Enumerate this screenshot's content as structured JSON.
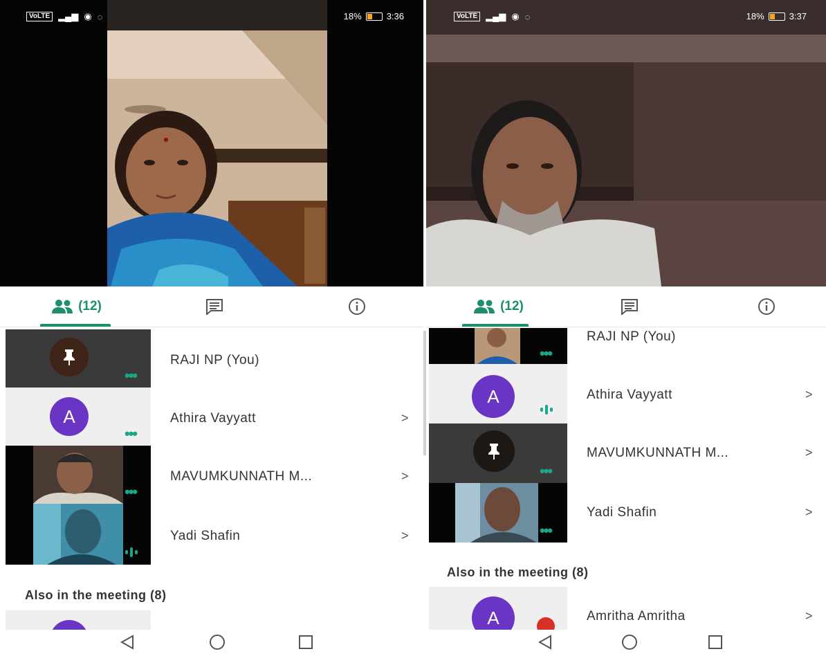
{
  "left": {
    "status": {
      "battery": "18%",
      "time": "3:36"
    },
    "tabs": {
      "people_count": "(12)"
    },
    "participants": [
      {
        "name": "RAJI NP (You)"
      },
      {
        "name": "Athira Vayyatt",
        "initial": "A"
      },
      {
        "name": "MAVUMKUNNATH M..."
      },
      {
        "name": "Yadi Shafin"
      }
    ],
    "also_label": "Also in the meeting (8)"
  },
  "right": {
    "status": {
      "battery": "18%",
      "time": "3:37"
    },
    "tabs": {
      "people_count": "(12)"
    },
    "participants": [
      {
        "name": "RAJI NP (You)"
      },
      {
        "name": "Athira Vayyatt",
        "initial": "A"
      },
      {
        "name": "MAVUMKUNNATH M..."
      },
      {
        "name": "Yadi Shafin"
      }
    ],
    "also_label": "Also in the meeting (8)",
    "also_participants": [
      {
        "name": "Amritha Amritha",
        "initial": "A"
      }
    ]
  },
  "icons": {
    "people": "people-icon",
    "chat": "chat-icon",
    "info": "info-icon",
    "chevron": "chevron-right-icon",
    "pin": "pin-icon",
    "more": "more-dots-icon",
    "speaking": "speaking-icon",
    "mic_off": "mic-off-icon",
    "back": "back-icon",
    "home": "home-icon",
    "recents": "recents-icon"
  },
  "colors": {
    "accent": "#1e8e6e",
    "avatar": "#6a35c4",
    "mic_off": "#d93025"
  }
}
